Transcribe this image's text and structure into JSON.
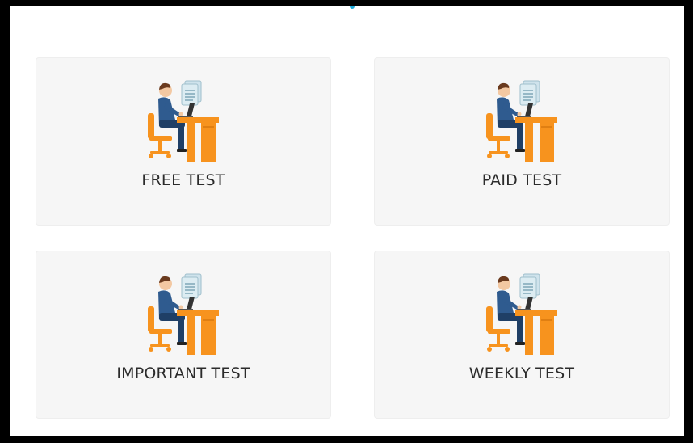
{
  "cards": [
    {
      "label": "FREE TEST",
      "icon": "person-at-desk-icon"
    },
    {
      "label": "PAID TEST",
      "icon": "person-at-desk-icon"
    },
    {
      "label": "IMPORTANT TEST",
      "icon": "person-at-desk-icon"
    },
    {
      "label": "WEEKLY TEST",
      "icon": "person-at-desk-icon"
    }
  ],
  "colors": {
    "card_background": "#f6f6f6",
    "label_text": "#2b2b2b",
    "desk_orange": "#f7931e",
    "suit_blue": "#2f5b8f",
    "document": "#cfe3ec",
    "accent": "#1aa8d8"
  }
}
